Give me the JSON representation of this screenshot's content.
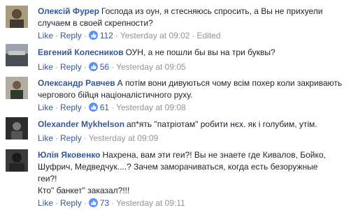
{
  "colors": {
    "link": "#365899",
    "text": "#1d2129",
    "meta": "#90949c",
    "like_icon": "#5890ff"
  },
  "comments": [
    {
      "author": "Олексій Фурер",
      "lines": [
        "Господа из оун, я стесняюсь спросить, а Вы не прихуели",
        "случаем в своей скрепности?"
      ],
      "like": "Like",
      "reply": "Reply",
      "likes": "112",
      "time": "Yesterday at 09:02",
      "edited": "Edited"
    },
    {
      "author": "Евгений Колесников",
      "lines": [
        "ОУН, а не пошли бы вы на три буквы?"
      ],
      "like": "Like",
      "reply": "Reply",
      "likes": "56",
      "time": "Yesterday at 09:05"
    },
    {
      "author": "Олександр Равчев",
      "lines": [
        "А потім вони дивуються чому всім похер коли закривають",
        "чергового бійця націоналістичного руху."
      ],
      "like": "Like",
      "reply": "Reply",
      "likes": "61",
      "time": "Yesterday at 09:08"
    },
    {
      "author": "Olexander Mykhelson",
      "lines": [
        "ап*ять \"патріотам\" робити нєх. як і голубим, утім."
      ],
      "like": "Like",
      "reply": "Reply",
      "time": "Yesterday at 09:09"
    },
    {
      "author": "Юлія Яковенко",
      "lines": [
        "Нахрена, вам эти геи?! Вы не знаете где Кивалов, Бойко,",
        "Шуфрич, Медведчук....? Зачем заморачиваться, когда есть безоружные",
        "геи?!",
        "Кто\" банкет\" заказал?!!!"
      ],
      "like": "Like",
      "reply": "Reply",
      "likes": "73",
      "time": "Yesterday at 09:11"
    }
  ]
}
